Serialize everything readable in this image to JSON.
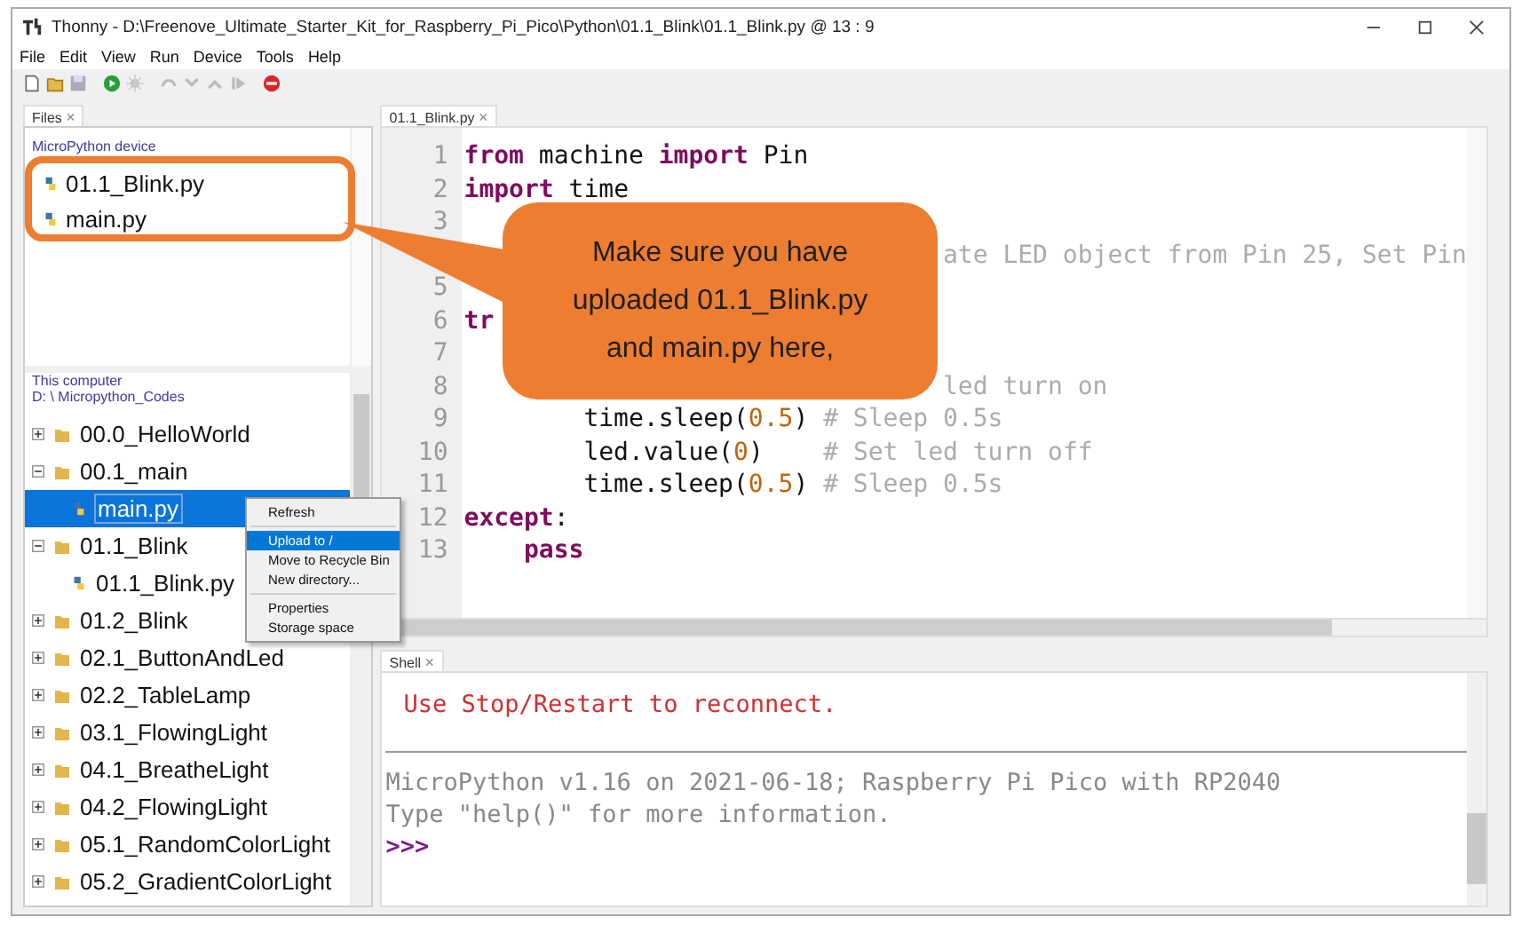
{
  "window": {
    "title": "Thonny  -  D:\\Freenove_Ultimate_Starter_Kit_for_Raspberry_Pi_Pico\\Python\\01.1_Blink\\01.1_Blink.py  @  13 : 9"
  },
  "menu": [
    "File",
    "Edit",
    "View",
    "Run",
    "Device",
    "Tools",
    "Help"
  ],
  "files_tab": {
    "label": "Files",
    "close": "×",
    "selected": true
  },
  "device_panel": {
    "title": "MicroPython device",
    "files": [
      {
        "name": "01.1_Blink.py",
        "selected": false
      },
      {
        "name": "main.py",
        "selected": false
      }
    ]
  },
  "computer_panel": {
    "title": "This computer",
    "path": "D: \\ Micropython_Codes",
    "tree": [
      {
        "name": "00.0_HelloWorld",
        "kind": "folder",
        "expanded": false,
        "selected": false
      },
      {
        "name": "00.1_main",
        "kind": "folder",
        "expanded": true,
        "selected": false,
        "children": [
          {
            "name": "main.py",
            "kind": "file",
            "selected": true
          }
        ]
      },
      {
        "name": "01.1_Blink",
        "kind": "folder",
        "expanded": true,
        "selected": false,
        "children": [
          {
            "name": "01.1_Blink.py",
            "kind": "file",
            "selected": false
          }
        ]
      },
      {
        "name": "01.2_Blink",
        "kind": "folder",
        "expanded": false,
        "selected": false
      },
      {
        "name": "02.1_ButtonAndLed",
        "kind": "folder",
        "expanded": false,
        "selected": false
      },
      {
        "name": "02.2_TableLamp",
        "kind": "folder",
        "expanded": false,
        "selected": false
      },
      {
        "name": "03.1_FlowingLight",
        "kind": "folder",
        "expanded": false,
        "selected": false
      },
      {
        "name": "04.1_BreatheLight",
        "kind": "folder",
        "expanded": false,
        "selected": false
      },
      {
        "name": "04.2_FlowingLight",
        "kind": "folder",
        "expanded": false,
        "selected": false
      },
      {
        "name": "05.1_RandomColorLight",
        "kind": "folder",
        "expanded": false,
        "selected": false
      },
      {
        "name": "05.2_GradientColorLight",
        "kind": "folder",
        "expanded": false,
        "selected": false
      }
    ]
  },
  "context_menu": {
    "groups": [
      [
        {
          "label": "Refresh",
          "selected": false
        }
      ],
      [
        {
          "label": "Upload to /",
          "selected": true
        },
        {
          "label": "Move to Recycle Bin",
          "selected": false
        },
        {
          "label": "New directory...",
          "selected": false
        }
      ],
      [
        {
          "label": "Properties",
          "selected": false
        },
        {
          "label": "Storage space",
          "selected": false
        }
      ]
    ]
  },
  "editor_tab": {
    "label": "01.1_Blink.py",
    "close": "×",
    "selected": true
  },
  "code_lines": [
    {
      "number": "1",
      "tokens": [
        {
          "kind": "keyword",
          "text": "from"
        },
        {
          "kind": "plain",
          "text": " machine "
        },
        {
          "kind": "keyword",
          "text": "import"
        },
        {
          "kind": "plain",
          "text": " Pin"
        }
      ]
    },
    {
      "number": "2",
      "tokens": [
        {
          "kind": "keyword",
          "text": "import"
        },
        {
          "kind": "plain",
          "text": " time"
        }
      ]
    },
    {
      "number": "3"
    },
    {
      "tokens": [
        {
          "kind": "comment",
          "text": "                                ate LED object from Pin 25, Set Pin"
        }
      ]
    },
    {
      "number": "5"
    },
    {
      "number": "6",
      "tokens": [
        {
          "kind": "keyword",
          "text": "tr"
        }
      ]
    },
    {
      "number": "7"
    },
    {
      "number": "8",
      "tokens": [
        {
          "kind": "comment",
          "text": "                                led turn on"
        }
      ]
    },
    {
      "number": "9",
      "tokens": [
        {
          "kind": "plain",
          "text": "        time.sleep("
        },
        {
          "kind": "number",
          "text": "0.5"
        },
        {
          "kind": "plain",
          "text": ") "
        },
        {
          "kind": "comment",
          "text": "# Sleep 0.5s"
        }
      ]
    },
    {
      "number": "10",
      "tokens": [
        {
          "kind": "plain",
          "text": "        led.value("
        },
        {
          "kind": "number",
          "text": "0"
        },
        {
          "kind": "plain",
          "text": ")    "
        },
        {
          "kind": "comment",
          "text": "# Set led turn off"
        }
      ]
    },
    {
      "number": "11",
      "tokens": [
        {
          "kind": "plain",
          "text": "        time.sleep("
        },
        {
          "kind": "number",
          "text": "0.5"
        },
        {
          "kind": "plain",
          "text": ") "
        },
        {
          "kind": "comment",
          "text": "# Sleep 0.5s"
        }
      ]
    },
    {
      "number": "12",
      "tokens": [
        {
          "kind": "keyword",
          "text": "except"
        },
        {
          "kind": "plain",
          "text": ":"
        }
      ]
    },
    {
      "number": "13",
      "tokens": [
        {
          "kind": "keyword",
          "text": "    pass"
        }
      ]
    }
  ],
  "shell_tab": {
    "label": "Shell",
    "close": "×",
    "selected": true
  },
  "shell": {
    "error": "Use Stop/Restart to reconnect.",
    "lines": [
      "MicroPython v1.16 on 2021-06-18; Raspberry Pi Pico with RP2040",
      "Type \"help()\" for more information."
    ],
    "prompt": ">>>"
  },
  "callout": {
    "text": "Make sure you have uploaded 01.1_Blink.py and main.py here,"
  }
}
